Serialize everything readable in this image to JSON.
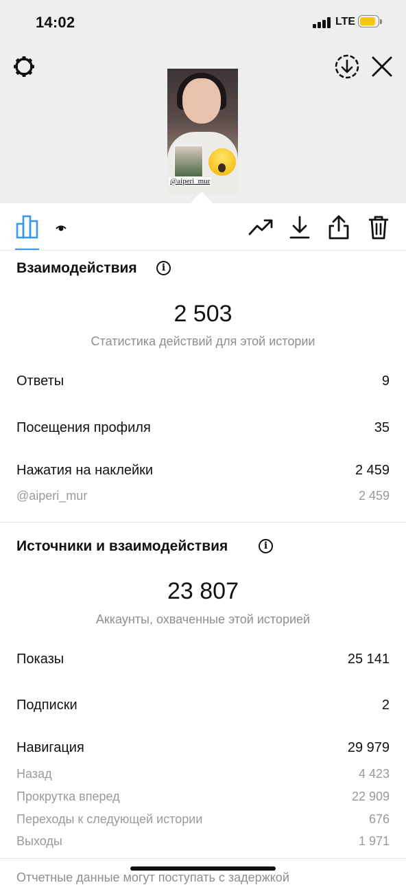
{
  "status_bar": {
    "time": "14:02",
    "network": "LTE"
  },
  "story_preview": {
    "sticker_tag": "@aiperi_mur"
  },
  "icons": {
    "settings": "gear-icon",
    "save_story": "download-circle-icon",
    "close": "close-icon",
    "insights_tab": "bar-chart-icon",
    "viewers_tab": "eye-icon",
    "promote": "trending-up-icon",
    "download": "download-icon",
    "share": "share-icon",
    "delete": "trash-icon"
  },
  "interactions": {
    "title": "Взаимодействия",
    "total": "2 503",
    "caption": "Статистика действий для этой истории",
    "rows": [
      {
        "label": "Ответы",
        "value": "9"
      },
      {
        "label": "Посещения профиля",
        "value": "35"
      },
      {
        "label": "Нажатия на наклейки",
        "value": "2 459"
      }
    ],
    "sticker_rows": [
      {
        "label": "@aiperi_mur",
        "value": "2 459"
      }
    ]
  },
  "discovery": {
    "title": "Источники и взаимодействия",
    "total": "23 807",
    "caption": "Аккаунты, охваченные этой историей",
    "rows": [
      {
        "label": "Показы",
        "value": "25 141"
      },
      {
        "label": "Подписки",
        "value": "2"
      },
      {
        "label": "Навигация",
        "value": "29 979"
      }
    ],
    "navigation_rows": [
      {
        "label": "Назад",
        "value": "4 423"
      },
      {
        "label": "Прокрутка вперед",
        "value": "22 909"
      },
      {
        "label": "Переходы к следующей истории",
        "value": "676"
      },
      {
        "label": "Выходы",
        "value": "1 971"
      }
    ]
  },
  "footnote": "Отчетные данные могут поступать с задержкой"
}
